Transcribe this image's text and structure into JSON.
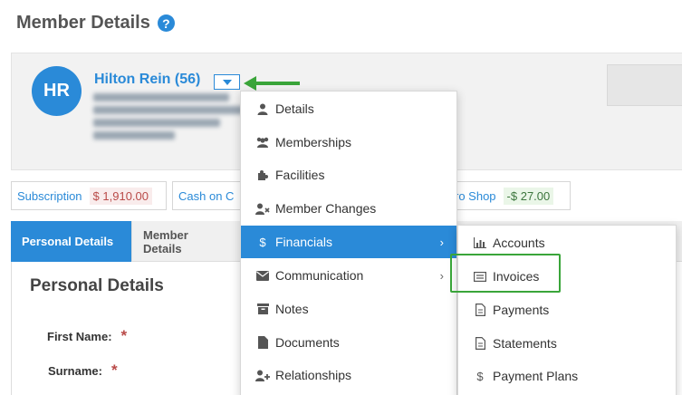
{
  "page": {
    "title": "Member Details",
    "help_icon": "?"
  },
  "member": {
    "initials": "HR",
    "name": "Hilton Rein (56)"
  },
  "summary": {
    "subscription_label": "Subscription",
    "subscription_amount": "$ 1,910.00",
    "cash_label": "Cash on C",
    "proshop_label": "ro Shop",
    "proshop_amount": "-$ 27.00"
  },
  "tabs": [
    {
      "label": "Personal Details",
      "active": true
    },
    {
      "label": "Member Details",
      "active": false
    }
  ],
  "content": {
    "section_title": "Personal Details",
    "first_name_label": "First Name:",
    "surname_label": "Surname:",
    "required_mark": "*"
  },
  "menu": {
    "items": [
      {
        "label": "Details",
        "icon": "user-icon"
      },
      {
        "label": "Memberships",
        "icon": "users-icon"
      },
      {
        "label": "Facilities",
        "icon": "puzzle-icon"
      },
      {
        "label": "Member Changes",
        "icon": "user-x-icon"
      },
      {
        "label": "Financials",
        "icon": "dollar-icon",
        "active": true,
        "has_submenu": true
      },
      {
        "label": "Communication",
        "icon": "envelope-icon",
        "has_submenu": true
      },
      {
        "label": "Notes",
        "icon": "archive-icon"
      },
      {
        "label": "Documents",
        "icon": "file-icon"
      },
      {
        "label": "Relationships",
        "icon": "user-plus-icon"
      }
    ]
  },
  "submenu": {
    "items": [
      {
        "label": "Accounts",
        "icon": "bar-chart-icon"
      },
      {
        "label": "Invoices",
        "icon": "list-icon"
      },
      {
        "label": "Payments",
        "icon": "file-text-icon"
      },
      {
        "label": "Statements",
        "icon": "file-text-icon"
      },
      {
        "label": "Payment Plans",
        "icon": "dollar-icon"
      }
    ]
  },
  "colors": {
    "primary": "#2a8ad8",
    "annotation_green": "#3aa53a",
    "required_red": "#b94a48"
  }
}
